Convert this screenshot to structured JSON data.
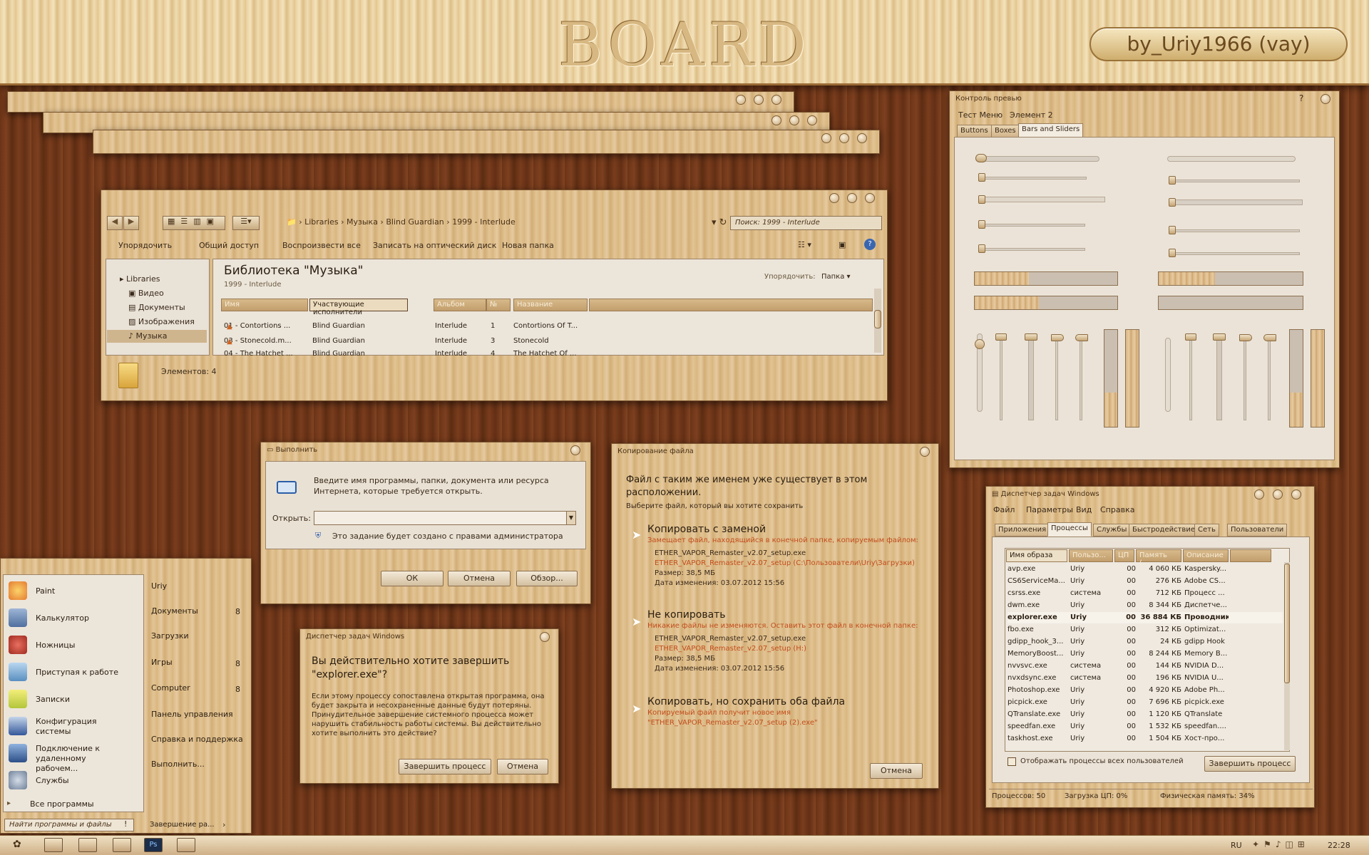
{
  "banner": {
    "title": "BOARD",
    "author": "by_Uriy1966 (vay)"
  },
  "explorer": {
    "breadcrumb": [
      "Libraries",
      "Музыка",
      "Blind Guardian",
      "1999 - Interlude"
    ],
    "search_placeholder": "Поиск: 1999 - Interlude",
    "toolbar": [
      "Упорядочить",
      "Общий доступ",
      "Воспроизвести все",
      "Записать на оптический диск",
      "Новая папка"
    ],
    "nav": [
      "Libraries",
      "Видео",
      "Документы",
      "Изображения",
      "Музыка"
    ],
    "library_title": "Библиотека \"Музыка\"",
    "library_subtitle": "1999 - Interlude",
    "arrange_label": "Упорядочить:",
    "arrange_value": "Папка",
    "columns": [
      "Имя",
      "Участвующие исполнители",
      "Альбом",
      "№",
      "Название"
    ],
    "rows": [
      [
        "01 - Contortions ...",
        "Blind Guardian",
        "Interlude",
        "1",
        "Contortions Of T..."
      ],
      [
        "03 - Stonecold.m...",
        "Blind Guardian",
        "Interlude",
        "3",
        "Stonecold"
      ],
      [
        "04 - The Hatchet ...",
        "Blind Guardian",
        "Interlude",
        "4",
        "The Hatchet Of ..."
      ]
    ],
    "status": "Элементов: 4"
  },
  "preview": {
    "title": "Контроль превью",
    "menu": [
      "Тест Меню",
      "Элемент 2"
    ],
    "tabs": [
      "Buttons",
      "Boxes",
      "Bars and Sliders"
    ],
    "help": "?",
    "horizontal_progress": [
      0.38,
      0.45,
      0.39,
      0.0
    ],
    "vertical_progress": [
      0.35,
      1.0,
      0.35,
      1.0
    ]
  },
  "run": {
    "title": "Выполнить",
    "prompt": "Введите имя программы, папки, документа или ресурса Интернета, которые требуется открыть.",
    "open_label": "Открыть:",
    "admin_note": "Это задание будет создано с правами администратора",
    "ok": "ОК",
    "cancel": "Отмена",
    "browse": "Обзор..."
  },
  "copy": {
    "title": "Копирование файла",
    "heading": "Файл с таким же именем уже существует в этом расположении.",
    "sub": "Выберите файл, который вы хотите сохранить",
    "opt1_title": "Копировать с заменой",
    "opt1_desc": "Замещает файл, находящийся в конечной папке, копируемым файлом:",
    "opt1_name": "ETHER_VAPOR_Remaster_v2.07_setup.exe",
    "opt1_path": "ETHER_VAPOR_Remaster_v2.07_setup (C:\\Пользователи\\Uriy\\Загрузки)",
    "opt1_size": "Размер: 38,5 МБ",
    "opt1_date": "Дата изменения: 03.07.2012 15:56",
    "opt2_title": "Не копировать",
    "opt2_desc": "Никакие файлы не изменяются. Оставить этот файл в конечной папке:",
    "opt2_name": "ETHER_VAPOR_Remaster_v2.07_setup.exe",
    "opt2_path": "ETHER_VAPOR_Remaster_v2.07_setup (H:)",
    "opt2_size": "Размер: 38,5 МБ",
    "opt2_date": "Дата изменения: 03.07.2012 15:56",
    "opt3_title": "Копировать, но сохранить оба файла",
    "opt3_desc": "Копируемый файл получит новое имя",
    "opt3_name": "\"ETHER_VAPOR_Remaster_v2.07_setup (2).exe\"",
    "cancel": "Отмена"
  },
  "endtask": {
    "title": "Диспетчер задач Windows",
    "question": "Вы действительно хотите завершить \"explorer.exe\"?",
    "body": "Если этому процессу сопоставлена открытая программа, она будет закрыта и несохраненные данные будут потеряны. Принудительное завершение системного процесса может нарушить стабильность работы системы. Вы действительно хотите выполнить это действие?",
    "end": "Завершить процесс",
    "cancel": "Отмена"
  },
  "taskmgr": {
    "title": "Диспетчер задач Windows",
    "menu": [
      "Файл",
      "Параметры",
      "Вид",
      "Справка"
    ],
    "tabs": [
      "Приложения",
      "Процессы",
      "Службы",
      "Быстродействие",
      "Сеть",
      "Пользователи"
    ],
    "columns": [
      "Имя образа",
      "Пользо...",
      "ЦП",
      "Память (...",
      "Описание"
    ],
    "rows": [
      [
        "avp.exe",
        "Uriy",
        "00",
        "4 060 КБ",
        "Kaspersky..."
      ],
      [
        "CS6ServiceMa...",
        "Uriy",
        "00",
        "276 КБ",
        "Adobe CS..."
      ],
      [
        "csrss.exe",
        "система",
        "00",
        "712 КБ",
        "Процесс ..."
      ],
      [
        "dwm.exe",
        "Uriy",
        "00",
        "8 344 КБ",
        "Диспетче..."
      ],
      [
        "explorer.exe",
        "Uriy",
        "00",
        "36 884 КБ",
        "Проводник"
      ],
      [
        "fbo.exe",
        "Uriy",
        "00",
        "312 КБ",
        "Optimizat..."
      ],
      [
        "gdipp_hook_3...",
        "Uriy",
        "00",
        "24 КБ",
        "gdipp Hook"
      ],
      [
        "MemoryBoost...",
        "Uriy",
        "00",
        "8 244 КБ",
        "Memory B..."
      ],
      [
        "nvvsvc.exe",
        "система",
        "00",
        "144 КБ",
        "NVIDIA D..."
      ],
      [
        "nvxdsync.exe",
        "система",
        "00",
        "196 КБ",
        "NVIDIA U..."
      ],
      [
        "Photoshop.exe",
        "Uriy",
        "00",
        "4 920 КБ",
        "Adobe Ph..."
      ],
      [
        "picpick.exe",
        "Uriy",
        "00",
        "7 696 КБ",
        "picpick.exe"
      ],
      [
        "QTranslate.exe",
        "Uriy",
        "00",
        "1 120 КБ",
        "QTranslate"
      ],
      [
        "speedfan.exe",
        "Uriy",
        "00",
        "1 532 КБ",
        "speedfan...."
      ],
      [
        "taskhost.exe",
        "Uriy",
        "00",
        "1 504 КБ",
        "Хост-про..."
      ]
    ],
    "show_all": "Отображать процессы всех пользователей",
    "end_button": "Завершить процесс",
    "status_processes": "Процессов: 50",
    "status_cpu": "Загрузка ЦП: 0%",
    "status_mem": "Физическая память: 34%"
  },
  "start": {
    "programs": [
      "Paint",
      "Калькулятор",
      "Ножницы",
      "Приступая к работе",
      "Записки",
      "Конфигурация системы",
      "Подключение к удаленному рабочем...",
      "Службы"
    ],
    "all_programs": "Все программы",
    "places": [
      {
        "label": "Uriy",
        "badge": ""
      },
      {
        "label": "Документы",
        "badge": "8"
      },
      {
        "label": "Загрузки",
        "badge": ""
      },
      {
        "label": "Игры",
        "badge": "8"
      },
      {
        "label": "Computer",
        "badge": "8"
      },
      {
        "label": "Панель управления",
        "badge": ""
      },
      {
        "label": "Справка и поддержка",
        "badge": ""
      },
      {
        "label": "Выполнить...",
        "badge": ""
      }
    ],
    "search_placeholder": "Найти программы и файлы",
    "shutdown": "Завершение ра..."
  },
  "taskbar": {
    "lang": "RU",
    "clock": "22:28",
    "ps_label": "Ps"
  }
}
